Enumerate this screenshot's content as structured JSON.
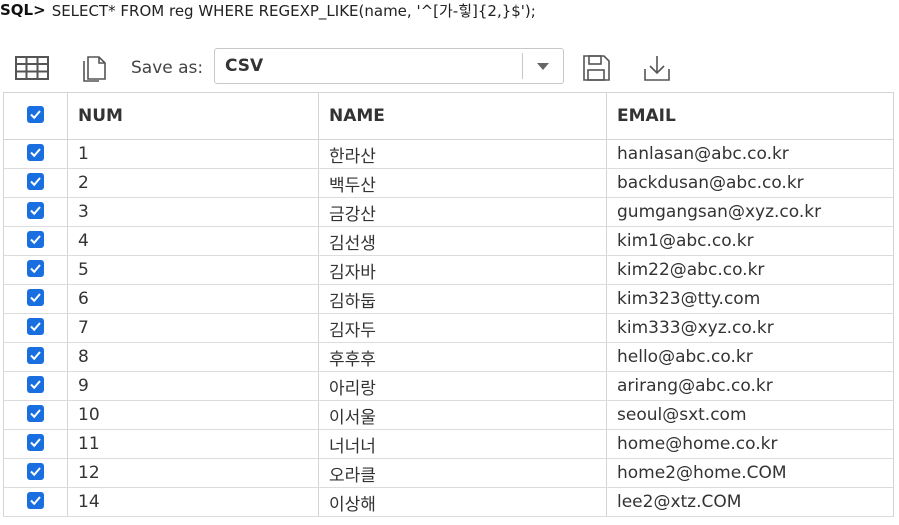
{
  "sql": {
    "prompt": "SQL>",
    "query": "SELECT* FROM reg WHERE REGEXP_LIKE(name, '^[가-힣]{2,}$');"
  },
  "toolbar": {
    "grid_icon": "table-grid-icon",
    "copy_icon": "copy-icon",
    "save_as_label": "Save as:",
    "format_value": "CSV",
    "save_icon": "floppy-disk-icon",
    "download_icon": "download-icon"
  },
  "table": {
    "columns": [
      "NUM",
      "NAME",
      "EMAIL"
    ],
    "rows": [
      {
        "num": "1",
        "name": "한라산",
        "email": "hanlasan@abc.co.kr"
      },
      {
        "num": "2",
        "name": "백두산",
        "email": "backdusan@abc.co.kr"
      },
      {
        "num": "3",
        "name": "금강산",
        "email": "gumgangsan@xyz.co.kr"
      },
      {
        "num": "4",
        "name": "김선생",
        "email": "kim1@abc.co.kr"
      },
      {
        "num": "5",
        "name": "김자바",
        "email": "kim22@abc.co.kr"
      },
      {
        "num": "6",
        "name": "김하둡",
        "email": "kim323@tty.com"
      },
      {
        "num": "7",
        "name": "김자두",
        "email": "kim333@xyz.co.kr"
      },
      {
        "num": "8",
        "name": "후후후",
        "email": "hello@abc.co.kr"
      },
      {
        "num": "9",
        "name": "아리랑",
        "email": "arirang@abc.co.kr"
      },
      {
        "num": "10",
        "name": "이서울",
        "email": "seoul@sxt.com"
      },
      {
        "num": "11",
        "name": "너너너",
        "email": "home@home.co.kr"
      },
      {
        "num": "12",
        "name": "오라클",
        "email": "home2@home.COM"
      },
      {
        "num": "14",
        "name": "이상해",
        "email": "lee2@xtz.COM"
      }
    ]
  },
  "colors": {
    "checkbox": "#1a6fe0",
    "border": "#d4d4d4"
  }
}
